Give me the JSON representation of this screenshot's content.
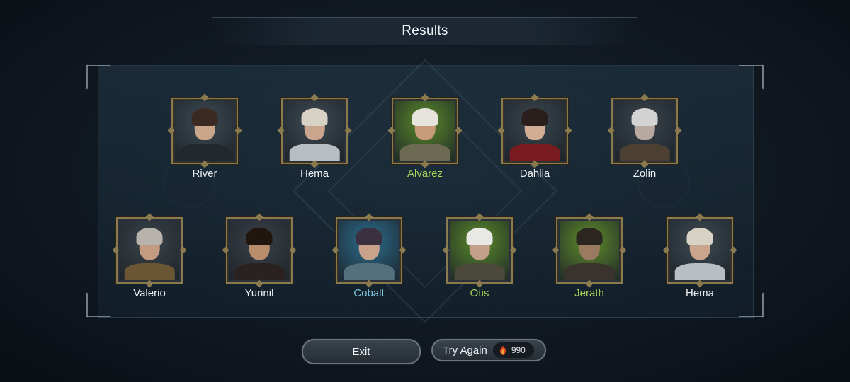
{
  "header": {
    "title": "Results"
  },
  "heroes_row1": [
    {
      "name": "River",
      "rarity": "normal",
      "bg": "#3d4a52",
      "skin": "#c9a58a",
      "hair": "#3a2a22",
      "cloth": "#23282e"
    },
    {
      "name": "Hema",
      "rarity": "normal",
      "bg": "#3f4a52",
      "skin": "#c8a58c",
      "hair": "#d8d2c4",
      "cloth": "#b9bec3"
    },
    {
      "name": "Alvarez",
      "rarity": "rare",
      "bg": "#5a8a2a",
      "skin": "#c79a7a",
      "hair": "#e6e3dc",
      "cloth": "#6c6a52"
    },
    {
      "name": "Dahlia",
      "rarity": "normal",
      "bg": "#3b464e",
      "skin": "#d2ad96",
      "hair": "#2a1f1c",
      "cloth": "#7a1c1f"
    },
    {
      "name": "Zolin",
      "rarity": "normal",
      "bg": "#3a444c",
      "skin": "#b7a9a0",
      "hair": "#d3d3d3",
      "cloth": "#4b4032"
    }
  ],
  "heroes_row2": [
    {
      "name": "Valerio",
      "rarity": "normal",
      "bg": "#3b444b",
      "skin": "#c39b80",
      "hair": "#b7b2ab",
      "cloth": "#6b5634"
    },
    {
      "name": "Yurinil",
      "rarity": "normal",
      "bg": "#3a4148",
      "skin": "#b98c6c",
      "hair": "#20160f",
      "cloth": "#2a2220"
    },
    {
      "name": "Cobalt",
      "rarity": "blue",
      "bg": "#2c6c8c",
      "skin": "#c9a28c",
      "hair": "#3b3040",
      "cloth": "#54707d"
    },
    {
      "name": "Otis",
      "rarity": "rare",
      "bg": "#5a8a2a",
      "skin": "#c3a08a",
      "hair": "#e8e8e4",
      "cloth": "#4b4a3a"
    },
    {
      "name": "Jerath",
      "rarity": "rare",
      "bg": "#5f8c2c",
      "skin": "#9b7a62",
      "hair": "#2c2620",
      "cloth": "#3a322c"
    },
    {
      "name": "Hema",
      "rarity": "normal",
      "bg": "#3f4a52",
      "skin": "#c8a58c",
      "hair": "#d8d2c4",
      "cloth": "#b9bec3"
    }
  ],
  "buttons": {
    "exit_label": "Exit",
    "try_again_label": "Try Again",
    "try_again_cost": "990",
    "cost_icon": "flame-gem-icon"
  }
}
